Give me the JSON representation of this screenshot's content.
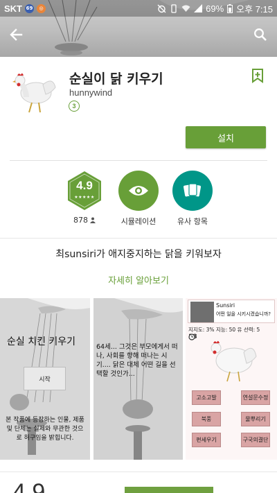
{
  "status_bar": {
    "carrier": "SKT",
    "badge1": "69",
    "battery": "69%",
    "time": "오후 7:15"
  },
  "header": {
    "back_icon": "arrow-left-icon",
    "search_icon": "search-icon"
  },
  "app": {
    "title": "순실이 닭 키우기",
    "developer": "hunnywind",
    "age_rating": "3",
    "install_label": "설치"
  },
  "stats": {
    "rating": "4.9",
    "review_count": "878",
    "category_label": "시뮬레이션",
    "similar_label": "유사 항목"
  },
  "description": {
    "tagline": "최sunsiri가 애지중지하는 닭을 키워보자",
    "more_label": "자세히 알아보기"
  },
  "screenshots": {
    "s1": {
      "title": "순실 치킨 키우기",
      "start": "시작",
      "note": "본 작품에 등장하는 인물, 제품 및 단체는 실제와 무관한 것으로 허구임을 밝힙니다."
    },
    "s2": {
      "text": "64세... 그것은 부모에게서 떠나, 사회를 향해 떠나는 시기.... 닭은 대체 어떤 길을 선택할 것인가..."
    },
    "s3": {
      "name": "Sunsiri",
      "question": "어떤 일을 시키시겠습니까?",
      "stats": "지지도: 3% 지능: 50 유 선력: 5",
      "timer": "18",
      "buttons": [
        "고소고발",
        "연설문수정",
        "북풍",
        "물뿌리기",
        "편세우기",
        "구국의결단"
      ]
    }
  },
  "bottom": {
    "rating_partial": "4.9"
  },
  "colors": {
    "accent": "#689f38",
    "shot3_bg": "#fdf6f6",
    "shot3_button": "#d9a4a4"
  }
}
